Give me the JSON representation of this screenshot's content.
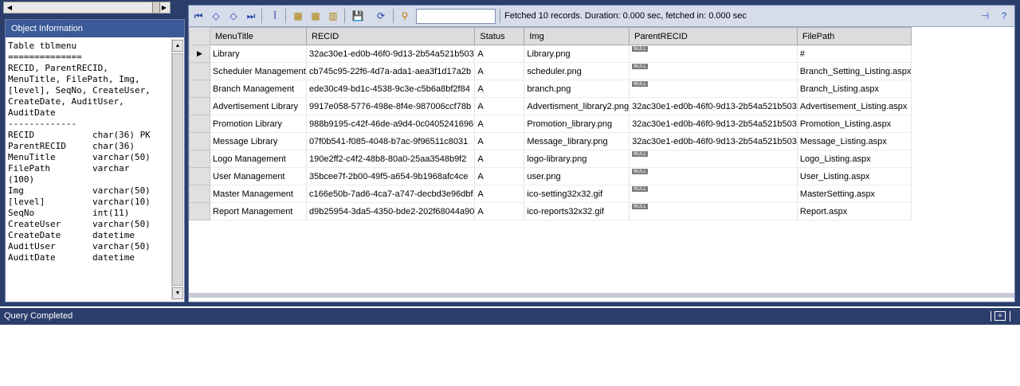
{
  "object_info": {
    "title": "Object Information",
    "body": "Table tblmenu\n==============\nRECID, ParentRECID,\nMenuTitle, FilePath, Img,\n[level], SeqNo, CreateUser,\nCreateDate, AuditUser,\nAuditDate\n-------------\nRECID           char(36) PK\nParentRECID     char(36)\nMenuTitle       varchar(50)\nFilePath        varchar\n(100)\nImg             varchar(50)\n[level]         varchar(10)\nSeqNo           int(11)\nCreateUser      varchar(50)\nCreateDate      datetime\nAuditUser       varchar(50)\nAuditDate       datetime"
  },
  "toolbar": {
    "filter_value": "",
    "status": "Fetched 10 records. Duration: 0.000 sec, fetched in: 0.000 sec"
  },
  "grid": {
    "columns": [
      "MenuTitle",
      "RECID",
      "Status",
      "Img",
      "ParentRECID",
      "FilePath"
    ],
    "null_label": "NULL",
    "rows": [
      {
        "menutitle": "Library",
        "recid": "32ac30e1-ed0b-46f0-9d13-2b54a521b503",
        "status": "A",
        "img": "Library.png",
        "parent": null,
        "filepath": "#"
      },
      {
        "menutitle": "Scheduler Management",
        "recid": "cb745c95-22f6-4d7a-ada1-aea3f1d17a2b",
        "status": "A",
        "img": "scheduler.png",
        "parent": null,
        "filepath": "Branch_Setting_Listing.aspx"
      },
      {
        "menutitle": "Branch Management",
        "recid": "ede30c49-bd1c-4538-9c3e-c5b6a8bf2f84",
        "status": "A",
        "img": "branch.png",
        "parent": null,
        "filepath": "Branch_Listing.aspx"
      },
      {
        "menutitle": "Advertisement Library",
        "recid": "9917e058-5776-498e-8f4e-987006ccf78b",
        "status": "A",
        "img": "Advertisment_library2.png",
        "parent": "32ac30e1-ed0b-46f0-9d13-2b54a521b503",
        "filepath": "Advertisement_Listing.aspx"
      },
      {
        "menutitle": "Promotion Library",
        "recid": "988b9195-c42f-46de-a9d4-0c0405241696",
        "status": "A",
        "img": "Promotion_library.png",
        "parent": "32ac30e1-ed0b-46f0-9d13-2b54a521b503",
        "filepath": "Promotion_Listing.aspx"
      },
      {
        "menutitle": "Message Library",
        "recid": "07f0b541-f085-4048-b7ac-9f96511c8031",
        "status": "A",
        "img": "Message_library.png",
        "parent": "32ac30e1-ed0b-46f0-9d13-2b54a521b503",
        "filepath": "Message_Listing.aspx"
      },
      {
        "menutitle": "Logo Management",
        "recid": "190e2ff2-c4f2-48b8-80a0-25aa3548b9f2",
        "status": "A",
        "img": "logo-library.png",
        "parent": null,
        "filepath": "Logo_Listing.aspx"
      },
      {
        "menutitle": "User Management",
        "recid": "35bcee7f-2b00-49f5-a654-9b1968afc4ce",
        "status": "A",
        "img": "user.png",
        "parent": null,
        "filepath": "User_Listing.aspx"
      },
      {
        "menutitle": "Master Management",
        "recid": "c166e50b-7ad6-4ca7-a747-decbd3e96dbf",
        "status": "A",
        "img": "ico-setting32x32.gif",
        "parent": null,
        "filepath": "MasterSetting.aspx"
      },
      {
        "menutitle": "Report Management",
        "recid": "d9b25954-3da5-4350-bde2-202f68044a90",
        "status": "A",
        "img": "ico-reports32x32.gif",
        "parent": null,
        "filepath": "Report.aspx"
      }
    ]
  },
  "statusbar": {
    "text": "Query Completed"
  }
}
